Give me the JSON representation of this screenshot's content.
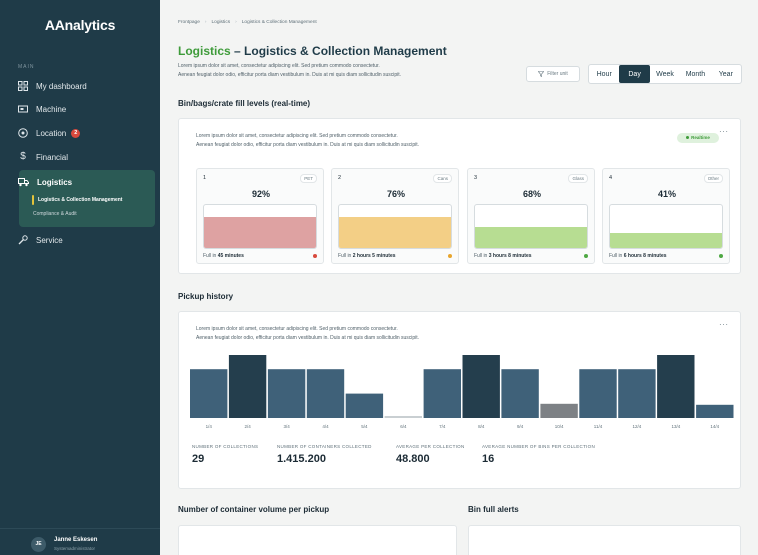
{
  "app": {
    "logo": "AAnalytics"
  },
  "sidebar": {
    "section_label": "MAIN",
    "items": [
      {
        "label": "My dashboard",
        "icon": "dashboard-grid-icon"
      },
      {
        "label": "Machine",
        "icon": "machine-icon"
      },
      {
        "label": "Location",
        "icon": "location-pin-icon",
        "badge": "2"
      },
      {
        "label": "Financial",
        "icon": "dollar-icon"
      },
      {
        "label": "Logistics",
        "icon": "truck-icon",
        "children": [
          "Logistics & Collection Management",
          "Compliance & Audit"
        ]
      },
      {
        "label": "Service",
        "icon": "wrench-icon"
      }
    ],
    "user": {
      "initials": "JE",
      "name": "Janne Eskesen",
      "role": "Systemadministrator"
    }
  },
  "breadcrumb": [
    "Frontpage",
    "Logistics",
    "Logistics & Collection Management"
  ],
  "page": {
    "title_highlight": "Logistics",
    "title_rest": " – Logistics & Collection Management",
    "desc_line1": "Lorem ipsum dolor sit amet, consectetur adipiscing elit. Sed pretium commodo consectetur.",
    "desc_line2": "Aenean feugiat dolor odio, efficitur porta diam vestibulum in. Duis at mi quis diam sollicitudin suscipit.",
    "filter_label": "Filter unit",
    "periods": [
      "Hour",
      "Day",
      "Week",
      "Month",
      "Year"
    ],
    "active_period": "Day"
  },
  "fill_section": {
    "title": "Bin/bags/crate fill levels (real-time)",
    "desc_line1": "Lorem ipsum dolor sit amet, consectetur adipiscing elit. Sed pretium commodo consectetur.",
    "desc_line2": "Aenean feugiat dolor odio, efficitur porta diam vestibulum in. Duis at mi quis diam sollicitudin suscipit.",
    "badge": "Realtime",
    "more": "···",
    "full_in_prefix": "Full in ",
    "bins": [
      {
        "num": "1",
        "type": "PET",
        "pct": "92%",
        "level": 0.72,
        "full_in": "45 minutes",
        "color": "#dea2a2",
        "dot": "#d8493d"
      },
      {
        "num": "2",
        "type": "Cans",
        "pct": "76%",
        "level": 0.72,
        "full_in": "2 hours 5 minutes",
        "color": "#f3cf86",
        "dot": "#e8a52d"
      },
      {
        "num": "3",
        "type": "Glass",
        "pct": "68%",
        "level": 0.48,
        "full_in": "3 hours 8 minutes",
        "color": "#b7dd92",
        "dot": "#4ea843"
      },
      {
        "num": "4",
        "type": "Other",
        "pct": "41%",
        "level": 0.36,
        "full_in": "6 hours 8 minutes",
        "color": "#b7dd92",
        "dot": "#4ea843"
      }
    ]
  },
  "pickup_section": {
    "title": "Pickup history",
    "desc_line1": "Lorem ipsum dolor sit amet, consectetur adipiscing elit. Sed pretium commodo consectetur.",
    "desc_line2": "Aenean feugiat dolor odio, efficitur porta diam vestibulum in. Duis at mi quis diam sollicitudin suscipit.",
    "more": "···",
    "stats": [
      {
        "label": "NUMBER OF COLLECTIONS",
        "value": "29"
      },
      {
        "label": "NUMBER OF CONTAINERS COLLECTED",
        "value": "1.415.200"
      },
      {
        "label": "AVERAGE PER COLLECTION",
        "value": "48.800"
      },
      {
        "label": "AVERAGE NUMBER OF BINS PER COLLECTION",
        "value": "16"
      }
    ]
  },
  "chart_data": {
    "type": "bar",
    "categories": [
      "1/4",
      "2/4",
      "3/4",
      "4/4",
      "5/4",
      "6/4",
      "7/4",
      "8/4",
      "9/4",
      "10/4",
      "11/4",
      "12/4",
      "13/4",
      "14/4"
    ],
    "values": [
      48,
      62,
      48,
      48,
      24,
      2,
      48,
      62,
      48,
      14,
      48,
      48,
      62,
      13
    ],
    "colors": [
      "#3f6179",
      "#243e4d",
      "#3f6179",
      "#3f6179",
      "#3f6179",
      "#c9cfd2",
      "#3f6179",
      "#243e4d",
      "#3f6179",
      "#7d8185",
      "#3f6179",
      "#3f6179",
      "#243e4d",
      "#3f6179"
    ],
    "ylim": [
      0,
      62
    ]
  },
  "bottom": {
    "volume_title": "Number of container volume per pickup",
    "alerts_title": "Bin full alerts"
  }
}
